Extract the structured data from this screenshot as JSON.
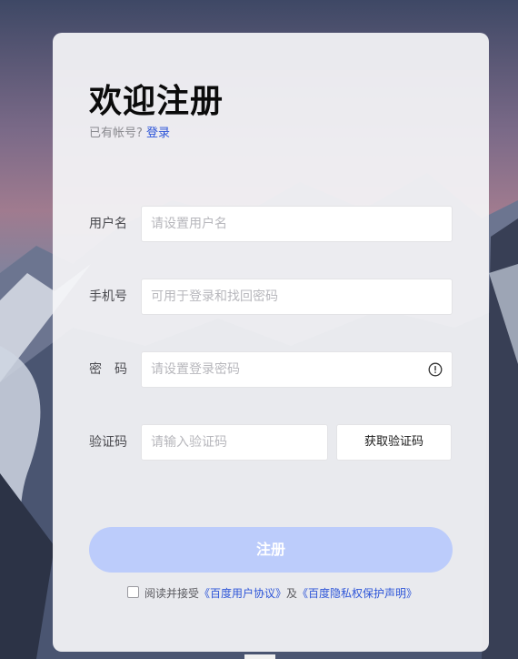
{
  "page": {
    "title": "欢迎注册",
    "has_account_text": "已有帐号?",
    "login_link": "登录"
  },
  "form": {
    "username": {
      "label": "用户名",
      "placeholder": "请设置用户名"
    },
    "phone": {
      "label": "手机号",
      "placeholder": "可用于登录和找回密码"
    },
    "password": {
      "label": "密　码",
      "placeholder": "请设置登录密码",
      "hint_icon": "info-icon"
    },
    "code": {
      "label": "验证码",
      "placeholder": "请输入验证码",
      "button": "获取验证码"
    },
    "submit": "注册"
  },
  "agreement": {
    "prefix": "阅读并接受",
    "user_agreement": "《百度用户协议》",
    "and": "及",
    "privacy_policy": "《百度隐私权保护声明》",
    "checked": false
  },
  "colors": {
    "accent": "#2d55d8",
    "submit_bg": "#bcccfb"
  }
}
